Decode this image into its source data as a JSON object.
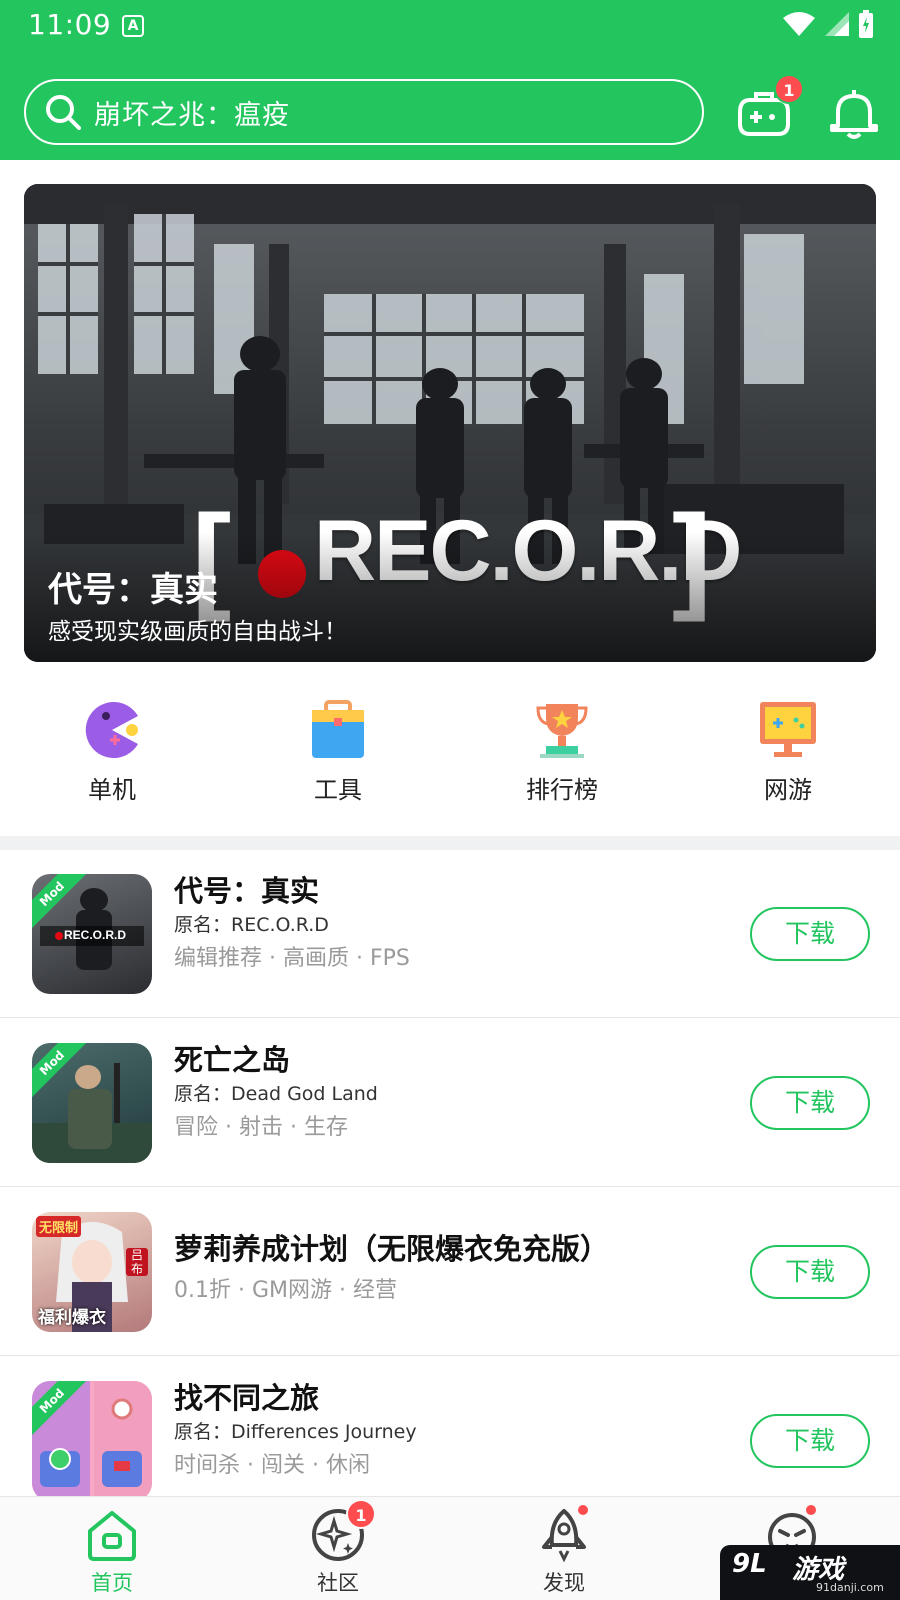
{
  "status_bar": {
    "time": "11:09",
    "indicator": "A"
  },
  "colors": {
    "accent": "#22c55e",
    "badge": "#ff4d4f",
    "rec_red": "#e50914"
  },
  "header": {
    "search_text": "崩坏之兆：瘟疫",
    "game_badge": "1",
    "icons": [
      "search-icon",
      "gamepad-icon",
      "bell-icon"
    ]
  },
  "banner": {
    "logo_text": "REC.O.R.D",
    "title": "代号：真实",
    "subtitle": "感受现实级画质的自由战斗！"
  },
  "categories": [
    {
      "label": "单机",
      "icon": "pacman-icon"
    },
    {
      "label": "工具",
      "icon": "toolbox-icon"
    },
    {
      "label": "排行榜",
      "icon": "trophy-icon"
    },
    {
      "label": "网游",
      "icon": "monitor-gamepad-icon"
    }
  ],
  "games": [
    {
      "name": "代号：真实",
      "original": "原名：REC.O.R.D",
      "tags": "编辑推荐 · 高画质 · FPS",
      "mod": "Mod",
      "thumb_text": "REC.O.R.D",
      "button": "下载"
    },
    {
      "name": "死亡之岛",
      "original": "原名：Dead God Land",
      "tags": "冒险 · 射击 · 生存",
      "mod": "Mod",
      "button": "下载"
    },
    {
      "name": "萝莉养成计划（无限爆衣免充版）",
      "tags": "0.1折 · GM网游 · 经营",
      "thumb_text_1": "无限制",
      "thumb_text_2": "福利爆衣",
      "thumb_text_3": "吕布",
      "button": "下载"
    },
    {
      "name": "找不同之旅",
      "original": "原名：Differences Journey",
      "tags": "时间杀 · 闯关 · 休闲",
      "mod": "Mod",
      "button": "下载"
    }
  ],
  "bottom_nav": [
    {
      "label": "首页",
      "icon": "home-icon",
      "active": true
    },
    {
      "label": "社区",
      "icon": "community-icon",
      "badge": "1"
    },
    {
      "label": "发现",
      "icon": "rocket-icon"
    },
    {
      "label": "",
      "icon": "face-icon"
    }
  ],
  "watermark": {
    "brand": "游戏",
    "logo": "9L",
    "url": "91danji.com"
  }
}
